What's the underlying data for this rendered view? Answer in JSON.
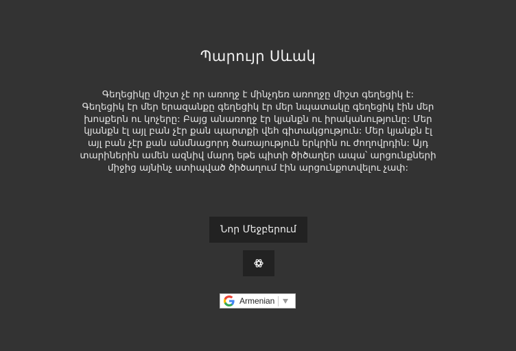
{
  "author": "Պարույր Սևակ",
  "quote": "Գեղեցիկը միշտ չէ որ առողջ է մինչդեռ առողջը միշտ գեղեցիկ է: Գեղեցիկ էր մեր երազանքը գեղեցիկ էր մեր նպատակը գեղեցիկ էին մեր խոսքերն ու կոչերը: Բայց անառողջ էր կյանքն ու իրականությունը: Մեր կյանքն էլ այլ բան չէր քան պարտքի վեհ գիտակցություն: Մեր կյանքն էլ այլ բան չէր քան անմնացորդ ծառայություն երկրին ու ժողովրդին: Այդ տարիներին ամեն ազնիվ մարդ եթե պիտի ծիծաղեր ապա՝ արցունքների միջից այնինչ ստիպված ծիծաղում էին արցունքոտվելու չափ:",
  "buttons": {
    "new_quote": "Նոր Մեջբերում",
    "chatgpt_icon": "chatgpt-logo-icon"
  },
  "language_selector": {
    "selected": "Armenian",
    "google_icon": "google-g-icon",
    "caret_icon": "caret-down-icon"
  },
  "colors": {
    "background": "#333333",
    "button_bg": "#222222",
    "text": "#f2f2f2"
  }
}
